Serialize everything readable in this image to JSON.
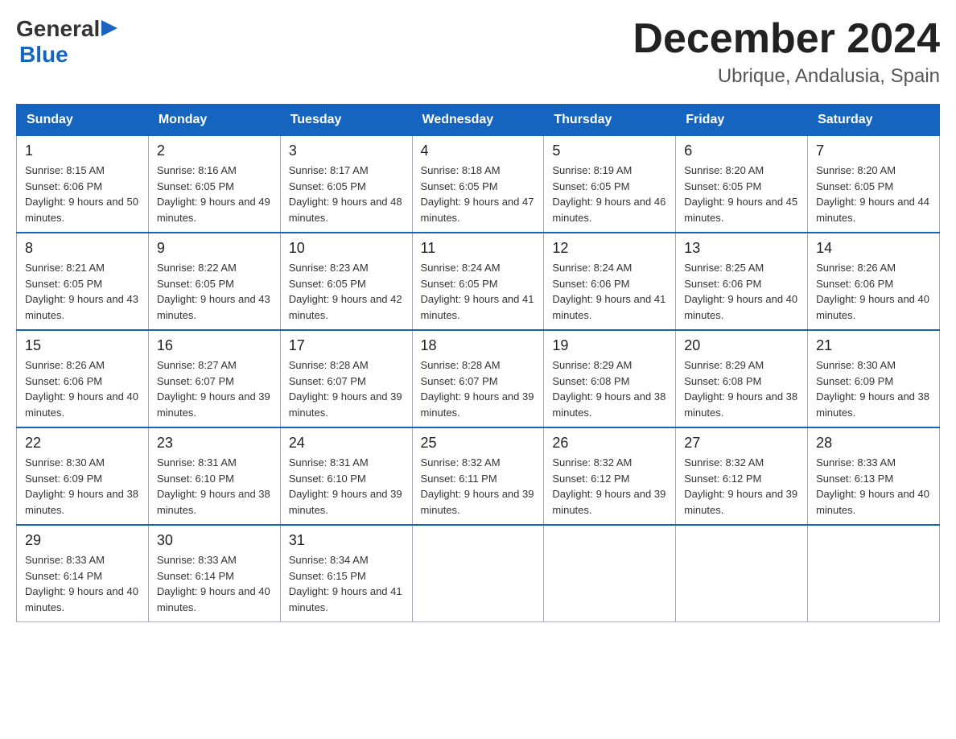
{
  "header": {
    "logo_general": "General",
    "logo_blue": "Blue",
    "month_title": "December 2024",
    "location": "Ubrique, Andalusia, Spain"
  },
  "days_of_week": [
    "Sunday",
    "Monday",
    "Tuesday",
    "Wednesday",
    "Thursday",
    "Friday",
    "Saturday"
  ],
  "weeks": [
    [
      {
        "day": "1",
        "sunrise": "8:15 AM",
        "sunset": "6:06 PM",
        "daylight": "9 hours and 50 minutes."
      },
      {
        "day": "2",
        "sunrise": "8:16 AM",
        "sunset": "6:05 PM",
        "daylight": "9 hours and 49 minutes."
      },
      {
        "day": "3",
        "sunrise": "8:17 AM",
        "sunset": "6:05 PM",
        "daylight": "9 hours and 48 minutes."
      },
      {
        "day": "4",
        "sunrise": "8:18 AM",
        "sunset": "6:05 PM",
        "daylight": "9 hours and 47 minutes."
      },
      {
        "day": "5",
        "sunrise": "8:19 AM",
        "sunset": "6:05 PM",
        "daylight": "9 hours and 46 minutes."
      },
      {
        "day": "6",
        "sunrise": "8:20 AM",
        "sunset": "6:05 PM",
        "daylight": "9 hours and 45 minutes."
      },
      {
        "day": "7",
        "sunrise": "8:20 AM",
        "sunset": "6:05 PM",
        "daylight": "9 hours and 44 minutes."
      }
    ],
    [
      {
        "day": "8",
        "sunrise": "8:21 AM",
        "sunset": "6:05 PM",
        "daylight": "9 hours and 43 minutes."
      },
      {
        "day": "9",
        "sunrise": "8:22 AM",
        "sunset": "6:05 PM",
        "daylight": "9 hours and 43 minutes."
      },
      {
        "day": "10",
        "sunrise": "8:23 AM",
        "sunset": "6:05 PM",
        "daylight": "9 hours and 42 minutes."
      },
      {
        "day": "11",
        "sunrise": "8:24 AM",
        "sunset": "6:05 PM",
        "daylight": "9 hours and 41 minutes."
      },
      {
        "day": "12",
        "sunrise": "8:24 AM",
        "sunset": "6:06 PM",
        "daylight": "9 hours and 41 minutes."
      },
      {
        "day": "13",
        "sunrise": "8:25 AM",
        "sunset": "6:06 PM",
        "daylight": "9 hours and 40 minutes."
      },
      {
        "day": "14",
        "sunrise": "8:26 AM",
        "sunset": "6:06 PM",
        "daylight": "9 hours and 40 minutes."
      }
    ],
    [
      {
        "day": "15",
        "sunrise": "8:26 AM",
        "sunset": "6:06 PM",
        "daylight": "9 hours and 40 minutes."
      },
      {
        "day": "16",
        "sunrise": "8:27 AM",
        "sunset": "6:07 PM",
        "daylight": "9 hours and 39 minutes."
      },
      {
        "day": "17",
        "sunrise": "8:28 AM",
        "sunset": "6:07 PM",
        "daylight": "9 hours and 39 minutes."
      },
      {
        "day": "18",
        "sunrise": "8:28 AM",
        "sunset": "6:07 PM",
        "daylight": "9 hours and 39 minutes."
      },
      {
        "day": "19",
        "sunrise": "8:29 AM",
        "sunset": "6:08 PM",
        "daylight": "9 hours and 38 minutes."
      },
      {
        "day": "20",
        "sunrise": "8:29 AM",
        "sunset": "6:08 PM",
        "daylight": "9 hours and 38 minutes."
      },
      {
        "day": "21",
        "sunrise": "8:30 AM",
        "sunset": "6:09 PM",
        "daylight": "9 hours and 38 minutes."
      }
    ],
    [
      {
        "day": "22",
        "sunrise": "8:30 AM",
        "sunset": "6:09 PM",
        "daylight": "9 hours and 38 minutes."
      },
      {
        "day": "23",
        "sunrise": "8:31 AM",
        "sunset": "6:10 PM",
        "daylight": "9 hours and 38 minutes."
      },
      {
        "day": "24",
        "sunrise": "8:31 AM",
        "sunset": "6:10 PM",
        "daylight": "9 hours and 39 minutes."
      },
      {
        "day": "25",
        "sunrise": "8:32 AM",
        "sunset": "6:11 PM",
        "daylight": "9 hours and 39 minutes."
      },
      {
        "day": "26",
        "sunrise": "8:32 AM",
        "sunset": "6:12 PM",
        "daylight": "9 hours and 39 minutes."
      },
      {
        "day": "27",
        "sunrise": "8:32 AM",
        "sunset": "6:12 PM",
        "daylight": "9 hours and 39 minutes."
      },
      {
        "day": "28",
        "sunrise": "8:33 AM",
        "sunset": "6:13 PM",
        "daylight": "9 hours and 40 minutes."
      }
    ],
    [
      {
        "day": "29",
        "sunrise": "8:33 AM",
        "sunset": "6:14 PM",
        "daylight": "9 hours and 40 minutes."
      },
      {
        "day": "30",
        "sunrise": "8:33 AM",
        "sunset": "6:14 PM",
        "daylight": "9 hours and 40 minutes."
      },
      {
        "day": "31",
        "sunrise": "8:34 AM",
        "sunset": "6:15 PM",
        "daylight": "9 hours and 41 minutes."
      },
      null,
      null,
      null,
      null
    ]
  ]
}
